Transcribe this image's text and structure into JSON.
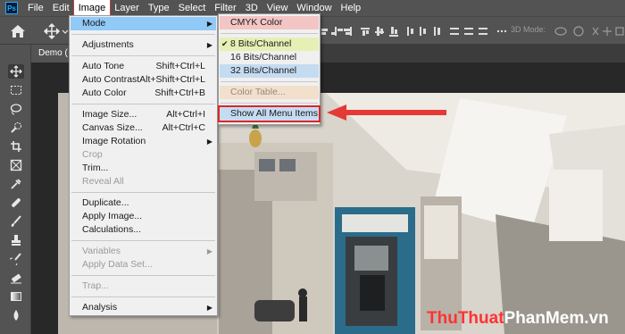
{
  "app": {
    "logo": "Ps"
  },
  "menubar": {
    "items": [
      "File",
      "Edit",
      "Image",
      "Layer",
      "Type",
      "Select",
      "Filter",
      "3D",
      "View",
      "Window",
      "Help"
    ],
    "active": "Image"
  },
  "optionsbar": {
    "mode_label": "3D Mode:"
  },
  "document": {
    "tab_label": "Demo ( "
  },
  "image_menu": {
    "mode": "Mode",
    "adjustments": "Adjustments",
    "auto_tone": "Auto Tone",
    "auto_tone_sc": "Shift+Ctrl+L",
    "auto_contrast": "Auto Contrast",
    "auto_contrast_sc": "Alt+Shift+Ctrl+L",
    "auto_color": "Auto Color",
    "auto_color_sc": "Shift+Ctrl+B",
    "image_size": "Image Size...",
    "image_size_sc": "Alt+Ctrl+I",
    "canvas_size": "Canvas Size...",
    "canvas_size_sc": "Alt+Ctrl+C",
    "image_rotation": "Image Rotation",
    "crop": "Crop",
    "trim": "Trim...",
    "reveal_all": "Reveal All",
    "duplicate": "Duplicate...",
    "apply_image": "Apply Image...",
    "calculations": "Calculations...",
    "variables": "Variables",
    "apply_data_set": "Apply Data Set...",
    "trap": "Trap...",
    "analysis": "Analysis"
  },
  "mode_menu": {
    "cmyk": "CMYK Color",
    "bits8": "8 Bits/Channel",
    "bits16": "16 Bits/Channel",
    "bits32": "32 Bits/Channel",
    "color_table": "Color Table...",
    "show_all": "Show All Menu Items"
  },
  "watermark": {
    "part1": "ThuThuat",
    "part2": "PhanMem",
    "part3": ".vn"
  },
  "colors": {
    "panel": "#535353",
    "menu_bg": "#f0f0f0",
    "highlight": "#91c9f7",
    "annotation_red": "#e02424"
  }
}
